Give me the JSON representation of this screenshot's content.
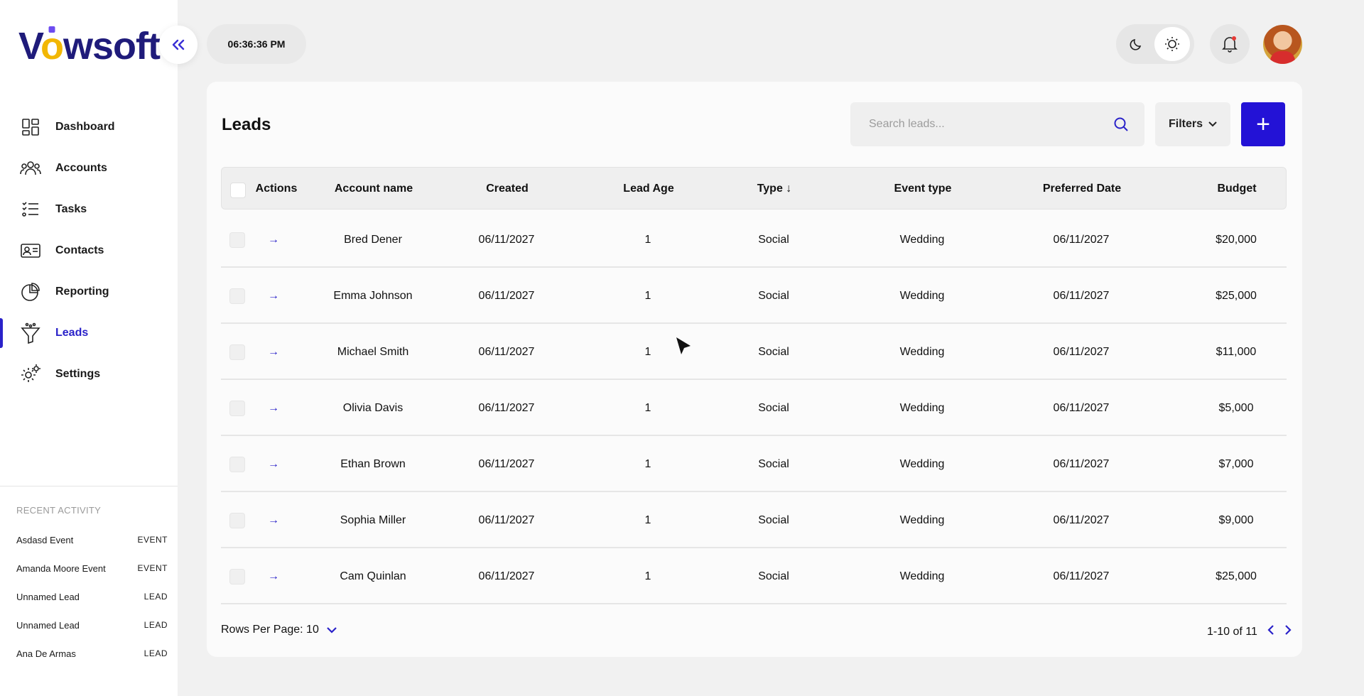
{
  "brand": {
    "name_pre": "V",
    "name_ring": "o",
    "name_post": "wsoft"
  },
  "clock": "06:36:36 PM",
  "nav": [
    {
      "label": "Dashboard",
      "icon": "dashboard-icon"
    },
    {
      "label": "Accounts",
      "icon": "users-icon"
    },
    {
      "label": "Tasks",
      "icon": "checklist-icon"
    },
    {
      "label": "Contacts",
      "icon": "contact-card-icon"
    },
    {
      "label": "Reporting",
      "icon": "pie-chart-icon"
    },
    {
      "label": "Leads",
      "icon": "funnel-icon",
      "active": true
    },
    {
      "label": "Settings",
      "icon": "gear-icon"
    }
  ],
  "recent": {
    "title": "RECENT ACTIVITY",
    "items": [
      {
        "name": "Asdasd Event",
        "type": "EVENT"
      },
      {
        "name": "Amanda Moore Event",
        "type": "EVENT"
      },
      {
        "name": "Unnamed Lead",
        "type": "LEAD"
      },
      {
        "name": "Unnamed Lead",
        "type": "LEAD"
      },
      {
        "name": "Ana De Armas",
        "type": "LEAD"
      }
    ]
  },
  "page": {
    "title": "Leads",
    "search_placeholder": "Search leads...",
    "filters_label": "Filters",
    "add_label": "+"
  },
  "table": {
    "columns": {
      "actions": "Actions",
      "account": "Account name",
      "created": "Created",
      "age": "Lead Age",
      "type": "Type",
      "type_sort": "↓",
      "event": "Event type",
      "preferred": "Preferred Date",
      "budget": "Budget"
    },
    "rows": [
      {
        "account": "Bred Dener",
        "created": "06/11/2027",
        "age": "1",
        "type": "Social",
        "event": "Wedding",
        "preferred": "06/11/2027",
        "budget": "$20,000"
      },
      {
        "account": "Emma Johnson",
        "created": "06/11/2027",
        "age": "1",
        "type": "Social",
        "event": "Wedding",
        "preferred": "06/11/2027",
        "budget": "$25,000"
      },
      {
        "account": "Michael Smith",
        "created": "06/11/2027",
        "age": "1",
        "type": "Social",
        "event": "Wedding",
        "preferred": "06/11/2027",
        "budget": "$11,000"
      },
      {
        "account": "Olivia Davis",
        "created": "06/11/2027",
        "age": "1",
        "type": "Social",
        "event": "Wedding",
        "preferred": "06/11/2027",
        "budget": "$5,000"
      },
      {
        "account": "Ethan Brown",
        "created": "06/11/2027",
        "age": "1",
        "type": "Social",
        "event": "Wedding",
        "preferred": "06/11/2027",
        "budget": "$7,000"
      },
      {
        "account": "Sophia Miller",
        "created": "06/11/2027",
        "age": "1",
        "type": "Social",
        "event": "Wedding",
        "preferred": "06/11/2027",
        "budget": "$9,000"
      },
      {
        "account": "Cam Quinlan",
        "created": "06/11/2027",
        "age": "1",
        "type": "Social",
        "event": "Wedding",
        "preferred": "06/11/2027",
        "budget": "$25,000"
      }
    ]
  },
  "footer": {
    "rows_per_page": "Rows Per Page: 10",
    "range": "1-10 of 11"
  },
  "colors": {
    "accent": "#2a22c9",
    "brand": "#1f1b7a",
    "ring": "#f2b705"
  }
}
